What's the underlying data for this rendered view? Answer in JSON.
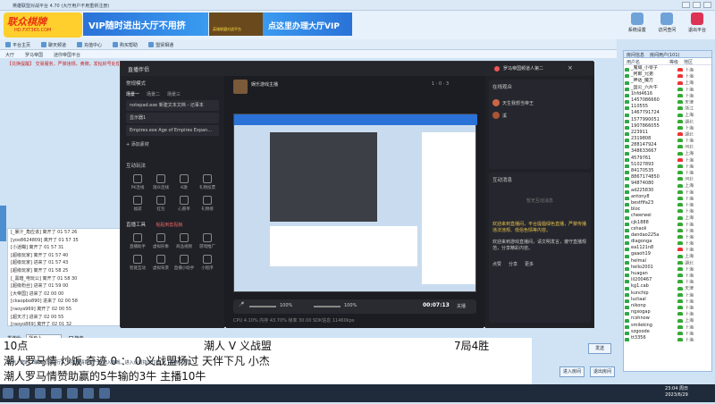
{
  "window": {
    "title": "英雄联盟对战平台 4.70 (大厅用户不用重新注册)"
  },
  "banner": {
    "logo_text": "联众棋牌",
    "logo_sub": "HD.FXT365.COM",
    "vip_left": "VIP随时进出大厅不用挤",
    "crest_text": "英雄联盟对战平台",
    "vip_right": "点这里办理大厅VIP"
  },
  "top_icons": [
    {
      "label": "系统设置"
    },
    {
      "label": "访问查问"
    },
    {
      "label": "退出平台"
    }
  ],
  "toolbar": {
    "items": [
      "平台主页",
      "聊天频道",
      "充值中心",
      "购买帮助",
      "盟贤相通"
    ]
  },
  "breadcrumb": {
    "items": [
      "大厅",
      "罗马帝国",
      "迷你帝国平台"
    ]
  },
  "notice": "【兑换提醒】 交易服务，严禁违规，黄牌，发帖封号处理",
  "chat_log": [
    "[_暴汁_角应该] 离开了 01 57 26",
    "[yoo8624809] 离开了 01 57 35",
    "[小迷糊] 离开了 01 57 31",
    "[超级玩家] 离开了 01 57 40",
    "[超级玩家] 进来了 01 57 43",
    "[超级玩家] 离开了 01 58 25",
    "[_黑暗_电玩公] 离开了 01 58 30",
    "[超级粉丝] 进来了 01 59 00",
    "[大帝国] 进来了 02 00 00",
    "[ckaopbo890] 进来了 02 00 58",
    "[raoya969] 离开了 02 00 55",
    "[超天才] 进来了 02 00 55",
    "[raoyo869] 离开了 02 01 32"
  ],
  "chat_input": {
    "label": "发送给:",
    "value": "所有人",
    "check": "静音"
  },
  "right_panel": {
    "tabs": [
      "房间信息",
      "房间用户(101)"
    ],
    "head": [
      "用户名",
      "等级",
      "地区"
    ],
    "users": [
      {
        "name": "_鬼域_小零子",
        "color": "#e33",
        "place": "上海"
      },
      {
        "name": "_阿郎_兄弟",
        "color": "#e33",
        "place": "上海"
      },
      {
        "name": "_神话_魔方",
        "color": "#e33",
        "place": "上海"
      },
      {
        "name": "_国公_六片牛",
        "color": "#3a3",
        "place": "上海"
      },
      {
        "name": "1hfd4616",
        "color": "#3a3",
        "place": "上海"
      },
      {
        "name": "1457086660",
        "color": "#3a3",
        "place": "天津"
      },
      {
        "name": "110555",
        "color": "#3a3",
        "place": "浙江"
      },
      {
        "name": "1467791724",
        "color": "#3a3",
        "place": "上海"
      },
      {
        "name": "1577990051",
        "color": "#3a3",
        "place": "湖北"
      },
      {
        "name": "1907866055",
        "color": "#3a3",
        "place": "上海"
      },
      {
        "name": "223911",
        "color": "#e33",
        "place": "湖北"
      },
      {
        "name": "2319808",
        "color": "#3a3",
        "place": "上海"
      },
      {
        "name": "288147924",
        "color": "#3a3",
        "place": "河北"
      },
      {
        "name": "348633667",
        "color": "#3a3",
        "place": "上海"
      },
      {
        "name": "4579761",
        "color": "#e33",
        "place": "上海"
      },
      {
        "name": "51027893",
        "color": "#3a3",
        "place": "上海"
      },
      {
        "name": "84170535",
        "color": "#3a3",
        "place": "上海"
      },
      {
        "name": "8867174850",
        "color": "#3a3",
        "place": "河北"
      },
      {
        "name": "94874080",
        "color": "#3a3",
        "place": "上海"
      },
      {
        "name": "ad225830",
        "color": "#3a3",
        "place": "上海"
      },
      {
        "name": "antony8",
        "color": "#3a3",
        "place": "上海"
      },
      {
        "name": "bestfifa23",
        "color": "#3a3",
        "place": "上海"
      },
      {
        "name": "bloc",
        "color": "#3a3",
        "place": "上海"
      },
      {
        "name": "cheerwei",
        "color": "#3a3",
        "place": "上海"
      },
      {
        "name": "cjk1888",
        "color": "#3a3",
        "place": "上海"
      },
      {
        "name": "cshaoli",
        "color": "#3a3",
        "place": "上海"
      },
      {
        "name": "dandao225a",
        "color": "#3a3",
        "place": "上海"
      },
      {
        "name": "diagonga",
        "color": "#3a3",
        "place": "上海"
      },
      {
        "name": "ea1121n8",
        "color": "#e33",
        "place": "上海"
      },
      {
        "name": "gaaoh19",
        "color": "#3a3",
        "place": "上海"
      },
      {
        "name": "helmal",
        "color": "#3a3",
        "place": "湖北"
      },
      {
        "name": "hello2001",
        "color": "#3a3",
        "place": "上海"
      },
      {
        "name": "huagan",
        "color": "#3a3",
        "place": "上海"
      },
      {
        "name": "lil200467",
        "color": "#3a3",
        "place": "上海"
      },
      {
        "name": "kg1.cab",
        "color": "#3a3",
        "place": "天津"
      },
      {
        "name": "kunchip",
        "color": "#3a3",
        "place": "上海"
      },
      {
        "name": "luctaal",
        "color": "#3a3",
        "place": "上海"
      },
      {
        "name": "nikonp",
        "color": "#3a3",
        "place": "上海"
      },
      {
        "name": "ngxogap",
        "color": "#3a3",
        "place": "上海"
      },
      {
        "name": "rcshnow",
        "color": "#3a3",
        "place": "上海"
      },
      {
        "name": "smileking",
        "color": "#3a3",
        "place": "上海"
      },
      {
        "name": "szgoode",
        "color": "#3a3",
        "place": "上海"
      },
      {
        "name": "tt3356",
        "color": "#3a3",
        "place": "上海"
      }
    ]
  },
  "obs": {
    "title": "直播伴侣",
    "user": "罗马帝国频道人第二",
    "mode": "常规模式",
    "scene_tabs": [
      "场景一",
      "场景二",
      "场景三"
    ],
    "scenes": [
      "notepad.exe 新建文本文档 - 记事本",
      "显示器1",
      "Empires.exe Age of Empires Expan..."
    ],
    "add_source": "+ 添加素材",
    "interact_title": "互动玩法",
    "interact": [
      {
        "label": "PK连线"
      },
      {
        "label": "观众连线"
      },
      {
        "label": "K歌"
      },
      {
        "label": "礼物投票"
      },
      {
        "label": "福袋"
      },
      {
        "label": "红包"
      },
      {
        "label": "心愿单"
      },
      {
        "label": "礼物榜"
      }
    ],
    "tools_title": "直播工具",
    "tools_tag": "粘贴到剪贴板",
    "tools": [
      {
        "label": "直播助手"
      },
      {
        "label": "虚拟形象"
      },
      {
        "label": "商品视频"
      },
      {
        "label": "游戏推广"
      },
      {
        "label": "智能互动"
      },
      {
        "label": "虚拟背景"
      },
      {
        "label": "直播小助手"
      },
      {
        "label": "小程序"
      }
    ],
    "stream_title": "娱乐游戏主播",
    "preview_counts": [
      "1",
      "0",
      "3"
    ],
    "volume1": "100%",
    "volume2": "100%",
    "timer": "00:07:13",
    "timer_label": "关播",
    "status": "CPU 4.10%  内存 43.70%  帧率 30.00  SDK信息 11460kps",
    "right_title": "在线观众",
    "audience_rows": [
      {
        "name": "天生我想当帝王",
        "rank": "1"
      },
      {
        "name": "溪",
        "rank": "2"
      }
    ],
    "messages_title": "互动消息",
    "empty": "暂无互动消息",
    "rules": "欢迎来到直播间，平台提倡绿色直播，严禁传播违法违规、低俗色情等内容。",
    "rules2": "欢迎来到游戏直播间，请文明发言，遵守直播规范，分享精彩内容。",
    "like": "点赞",
    "share": "分享",
    "more": "更多"
  },
  "video": {
    "l1a": "10点",
    "l1b": "潮人 V 义战盟",
    "l1c": "7局4胜",
    "l2": "潮人罗马情  炒饭  奇迹   0  ：   0   义战盟杨过  天伴下凡  小杰",
    "l3": "潮人罗马情赞助赢的5牛输的3牛    主播10牛"
  },
  "bottom": {
    "hint": "提示：您的【聊天门设信行】  快捷邀请好友一起加入游戏，进入设置指定位置上【聊天设定】",
    "enter_room": "进入房间",
    "send": "发送",
    "leave": "退出房间",
    "help": "帮助"
  },
  "taskbar": {
    "time": "23:04 周日",
    "date": "2023/6/29"
  }
}
